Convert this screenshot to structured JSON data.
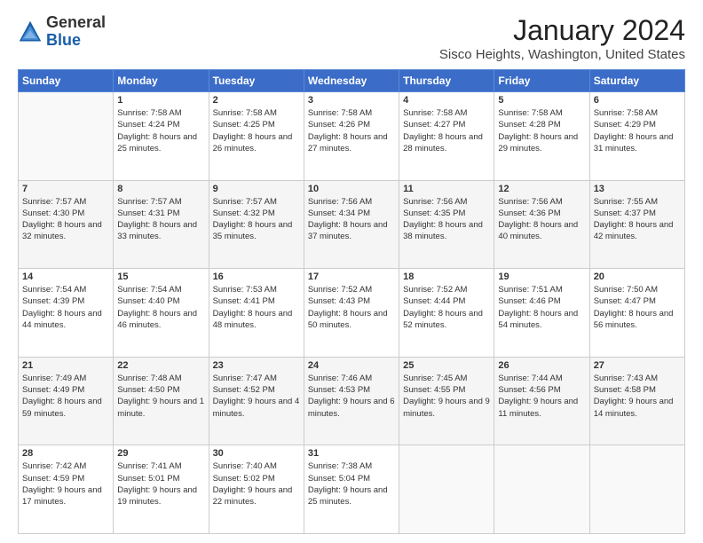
{
  "logo": {
    "general": "General",
    "blue": "Blue"
  },
  "header": {
    "month": "January 2024",
    "location": "Sisco Heights, Washington, United States"
  },
  "columns": [
    "Sunday",
    "Monday",
    "Tuesday",
    "Wednesday",
    "Thursday",
    "Friday",
    "Saturday"
  ],
  "weeks": [
    [
      {
        "day": "",
        "sunrise": "",
        "sunset": "",
        "daylight": ""
      },
      {
        "day": "1",
        "sunrise": "Sunrise: 7:58 AM",
        "sunset": "Sunset: 4:24 PM",
        "daylight": "Daylight: 8 hours and 25 minutes."
      },
      {
        "day": "2",
        "sunrise": "Sunrise: 7:58 AM",
        "sunset": "Sunset: 4:25 PM",
        "daylight": "Daylight: 8 hours and 26 minutes."
      },
      {
        "day": "3",
        "sunrise": "Sunrise: 7:58 AM",
        "sunset": "Sunset: 4:26 PM",
        "daylight": "Daylight: 8 hours and 27 minutes."
      },
      {
        "day": "4",
        "sunrise": "Sunrise: 7:58 AM",
        "sunset": "Sunset: 4:27 PM",
        "daylight": "Daylight: 8 hours and 28 minutes."
      },
      {
        "day": "5",
        "sunrise": "Sunrise: 7:58 AM",
        "sunset": "Sunset: 4:28 PM",
        "daylight": "Daylight: 8 hours and 29 minutes."
      },
      {
        "day": "6",
        "sunrise": "Sunrise: 7:58 AM",
        "sunset": "Sunset: 4:29 PM",
        "daylight": "Daylight: 8 hours and 31 minutes."
      }
    ],
    [
      {
        "day": "7",
        "sunrise": "Sunrise: 7:57 AM",
        "sunset": "Sunset: 4:30 PM",
        "daylight": "Daylight: 8 hours and 32 minutes."
      },
      {
        "day": "8",
        "sunrise": "Sunrise: 7:57 AM",
        "sunset": "Sunset: 4:31 PM",
        "daylight": "Daylight: 8 hours and 33 minutes."
      },
      {
        "day": "9",
        "sunrise": "Sunrise: 7:57 AM",
        "sunset": "Sunset: 4:32 PM",
        "daylight": "Daylight: 8 hours and 35 minutes."
      },
      {
        "day": "10",
        "sunrise": "Sunrise: 7:56 AM",
        "sunset": "Sunset: 4:34 PM",
        "daylight": "Daylight: 8 hours and 37 minutes."
      },
      {
        "day": "11",
        "sunrise": "Sunrise: 7:56 AM",
        "sunset": "Sunset: 4:35 PM",
        "daylight": "Daylight: 8 hours and 38 minutes."
      },
      {
        "day": "12",
        "sunrise": "Sunrise: 7:56 AM",
        "sunset": "Sunset: 4:36 PM",
        "daylight": "Daylight: 8 hours and 40 minutes."
      },
      {
        "day": "13",
        "sunrise": "Sunrise: 7:55 AM",
        "sunset": "Sunset: 4:37 PM",
        "daylight": "Daylight: 8 hours and 42 minutes."
      }
    ],
    [
      {
        "day": "14",
        "sunrise": "Sunrise: 7:54 AM",
        "sunset": "Sunset: 4:39 PM",
        "daylight": "Daylight: 8 hours and 44 minutes."
      },
      {
        "day": "15",
        "sunrise": "Sunrise: 7:54 AM",
        "sunset": "Sunset: 4:40 PM",
        "daylight": "Daylight: 8 hours and 46 minutes."
      },
      {
        "day": "16",
        "sunrise": "Sunrise: 7:53 AM",
        "sunset": "Sunset: 4:41 PM",
        "daylight": "Daylight: 8 hours and 48 minutes."
      },
      {
        "day": "17",
        "sunrise": "Sunrise: 7:52 AM",
        "sunset": "Sunset: 4:43 PM",
        "daylight": "Daylight: 8 hours and 50 minutes."
      },
      {
        "day": "18",
        "sunrise": "Sunrise: 7:52 AM",
        "sunset": "Sunset: 4:44 PM",
        "daylight": "Daylight: 8 hours and 52 minutes."
      },
      {
        "day": "19",
        "sunrise": "Sunrise: 7:51 AM",
        "sunset": "Sunset: 4:46 PM",
        "daylight": "Daylight: 8 hours and 54 minutes."
      },
      {
        "day": "20",
        "sunrise": "Sunrise: 7:50 AM",
        "sunset": "Sunset: 4:47 PM",
        "daylight": "Daylight: 8 hours and 56 minutes."
      }
    ],
    [
      {
        "day": "21",
        "sunrise": "Sunrise: 7:49 AM",
        "sunset": "Sunset: 4:49 PM",
        "daylight": "Daylight: 8 hours and 59 minutes."
      },
      {
        "day": "22",
        "sunrise": "Sunrise: 7:48 AM",
        "sunset": "Sunset: 4:50 PM",
        "daylight": "Daylight: 9 hours and 1 minute."
      },
      {
        "day": "23",
        "sunrise": "Sunrise: 7:47 AM",
        "sunset": "Sunset: 4:52 PM",
        "daylight": "Daylight: 9 hours and 4 minutes."
      },
      {
        "day": "24",
        "sunrise": "Sunrise: 7:46 AM",
        "sunset": "Sunset: 4:53 PM",
        "daylight": "Daylight: 9 hours and 6 minutes."
      },
      {
        "day": "25",
        "sunrise": "Sunrise: 7:45 AM",
        "sunset": "Sunset: 4:55 PM",
        "daylight": "Daylight: 9 hours and 9 minutes."
      },
      {
        "day": "26",
        "sunrise": "Sunrise: 7:44 AM",
        "sunset": "Sunset: 4:56 PM",
        "daylight": "Daylight: 9 hours and 11 minutes."
      },
      {
        "day": "27",
        "sunrise": "Sunrise: 7:43 AM",
        "sunset": "Sunset: 4:58 PM",
        "daylight": "Daylight: 9 hours and 14 minutes."
      }
    ],
    [
      {
        "day": "28",
        "sunrise": "Sunrise: 7:42 AM",
        "sunset": "Sunset: 4:59 PM",
        "daylight": "Daylight: 9 hours and 17 minutes."
      },
      {
        "day": "29",
        "sunrise": "Sunrise: 7:41 AM",
        "sunset": "Sunset: 5:01 PM",
        "daylight": "Daylight: 9 hours and 19 minutes."
      },
      {
        "day": "30",
        "sunrise": "Sunrise: 7:40 AM",
        "sunset": "Sunset: 5:02 PM",
        "daylight": "Daylight: 9 hours and 22 minutes."
      },
      {
        "day": "31",
        "sunrise": "Sunrise: 7:38 AM",
        "sunset": "Sunset: 5:04 PM",
        "daylight": "Daylight: 9 hours and 25 minutes."
      },
      {
        "day": "",
        "sunrise": "",
        "sunset": "",
        "daylight": ""
      },
      {
        "day": "",
        "sunrise": "",
        "sunset": "",
        "daylight": ""
      },
      {
        "day": "",
        "sunrise": "",
        "sunset": "",
        "daylight": ""
      }
    ]
  ]
}
